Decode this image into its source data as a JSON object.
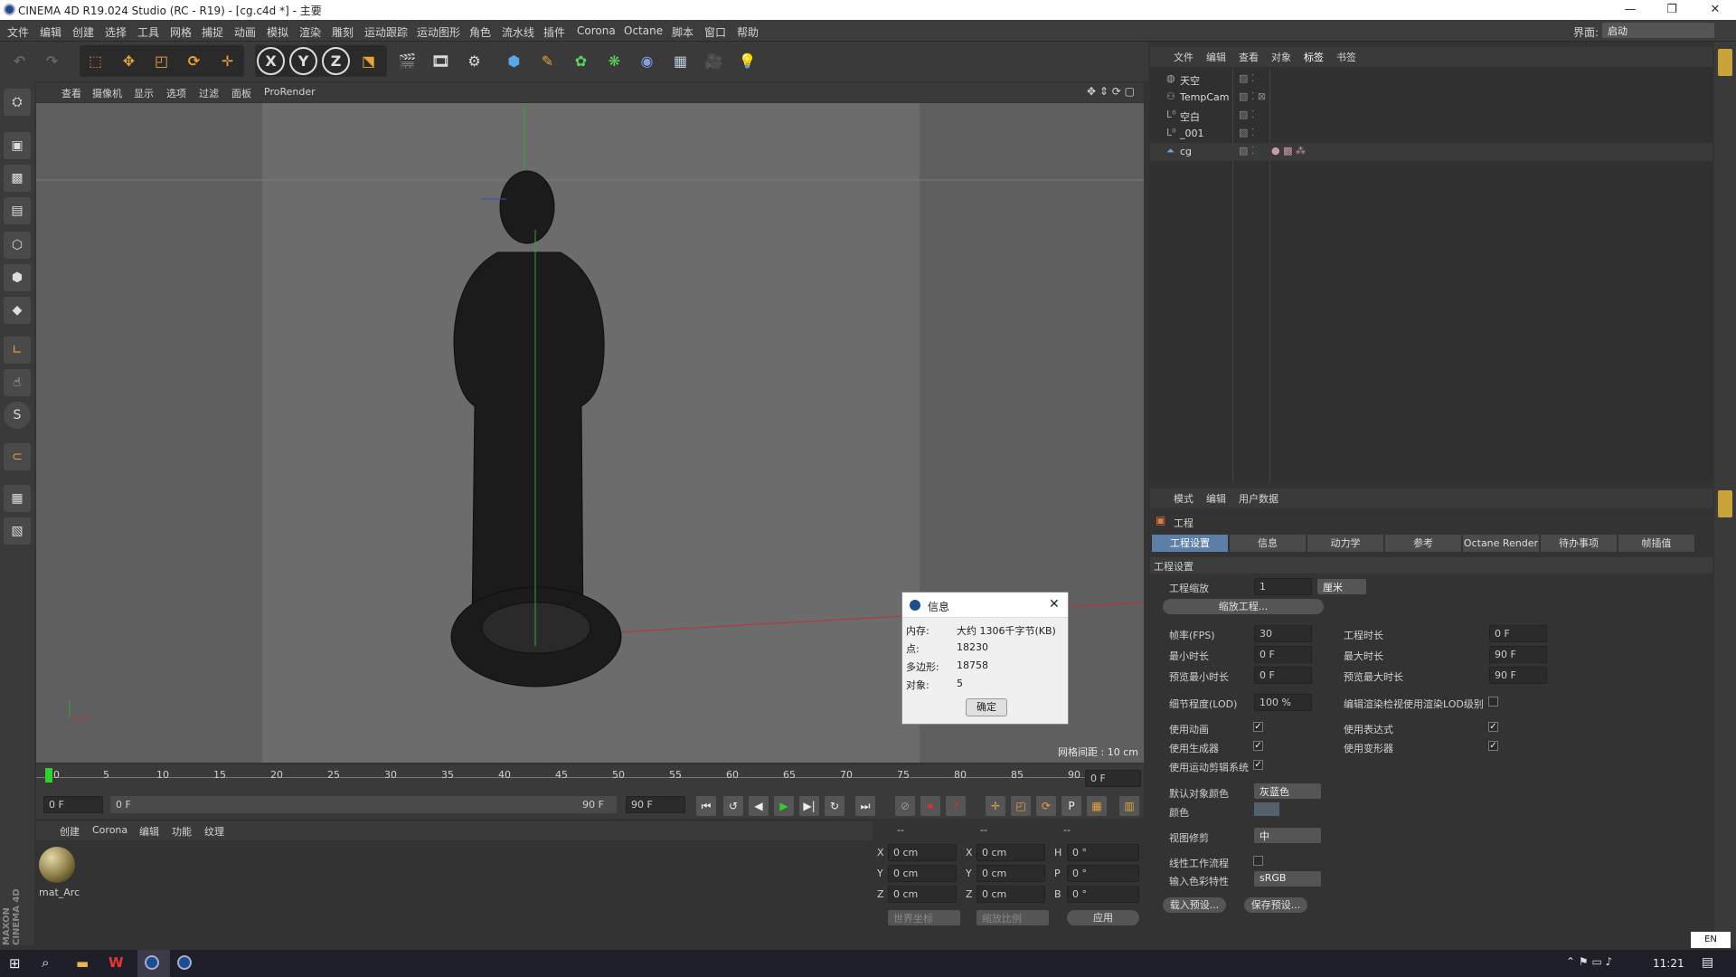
{
  "window": {
    "title": "CINEMA 4D R19.024 Studio (RC - R19) - [cg.c4d *] - 主要",
    "minimize": "—",
    "restore": "❐",
    "close": "✕"
  },
  "menu": [
    "文件",
    "编辑",
    "创建",
    "选择",
    "工具",
    "网格",
    "捕捉",
    "动画",
    "模拟",
    "渲染",
    "雕刻",
    "运动跟踪",
    "运动图形",
    "角色",
    "流水线",
    "插件",
    "Corona",
    "Octane",
    "脚本",
    "窗口",
    "帮助"
  ],
  "layout": {
    "label": "界面:",
    "value": "启动"
  },
  "toolbar": {
    "x": "X",
    "y": "Y",
    "z": "Z"
  },
  "viewport": {
    "menu": [
      "查看",
      "摄像机",
      "显示",
      "选项",
      "过滤",
      "面板",
      "ProRender"
    ],
    "grid_label": "网格间距 : 10 cm"
  },
  "timeline": {
    "ticks": [
      "0",
      "5",
      "10",
      "15",
      "20",
      "25",
      "30",
      "35",
      "40",
      "45",
      "50",
      "55",
      "60",
      "65",
      "70",
      "75",
      "80",
      "85",
      "90"
    ],
    "end": "0 F"
  },
  "playback": {
    "start": "0 F",
    "range_start": "0 F",
    "range_end": "90 F",
    "end": "90 F"
  },
  "material": {
    "menu": [
      "创建",
      "Corona",
      "编辑",
      "功能",
      "纹理"
    ],
    "name": "mat_Arc"
  },
  "coords": {
    "headers": [
      "--",
      "--",
      "--"
    ],
    "rows": [
      [
        "X",
        "0 cm",
        "X",
        "0 cm",
        "H",
        "0 °"
      ],
      [
        "Y",
        "0 cm",
        "Y",
        "0 cm",
        "P",
        "0 °"
      ],
      [
        "Z",
        "0 cm",
        "Z",
        "0 cm",
        "B",
        "0 °"
      ]
    ],
    "world": "世界坐标",
    "scale": "缩放比例",
    "apply": "应用"
  },
  "objects": {
    "menu": [
      "文件",
      "编辑",
      "查看",
      "对象",
      "标签",
      "书签"
    ],
    "items": [
      "天空",
      "TempCam",
      "空白",
      "_001",
      "cg"
    ]
  },
  "attributes": {
    "menu": [
      "模式",
      "编辑",
      "用户数据"
    ],
    "title": "工程",
    "tabs": [
      "工程设置",
      "信息",
      "动力学",
      "参考",
      "Octane Render",
      "待办事项",
      "帧插值"
    ],
    "section": "工程设置",
    "scale_label": "工程缩放",
    "scale_value": "1",
    "scale_unit": "厘米",
    "scale_btn": "缩放工程...",
    "fps_label": "帧率(FPS)",
    "fps": "30",
    "time_label": "工程时长",
    "time": "0 F",
    "min_label": "最小时长",
    "min": "0 F",
    "max_label": "最大时长",
    "max": "90 F",
    "pmin_label": "预览最小时长",
    "pmin": "0 F",
    "pmax_label": "预览最大时长",
    "pmax": "90 F",
    "lod_label": "细节程度(LOD)",
    "lod": "100 %",
    "lod_render": "编辑渲染检视使用渲染LOD级别",
    "anim": "使用动画",
    "expr": "使用表达式",
    "gen": "使用生成器",
    "deform": "使用变形器",
    "motion": "使用运动剪辑系统",
    "color_label": "默认对象颜色",
    "color_value": "灰蓝色",
    "color": "颜色",
    "clip_label": "视图修剪",
    "clip_value": "中",
    "linear": "线性工作流程",
    "profile_label": "输入色彩特性",
    "profile_value": "sRGB",
    "load": "载入预设...",
    "save": "保存预设..."
  },
  "dialog": {
    "title": "信息",
    "rows": [
      [
        "内存:",
        "大约 1306千字节(KB)"
      ],
      [
        "点:",
        "18230"
      ],
      [
        "多边形:",
        "18758"
      ],
      [
        "对象:",
        "5"
      ]
    ],
    "ok": "确定"
  },
  "taskbar": {
    "time": "11:21",
    "lang": "EN"
  },
  "brand": "MAXON CINEMA 4D"
}
